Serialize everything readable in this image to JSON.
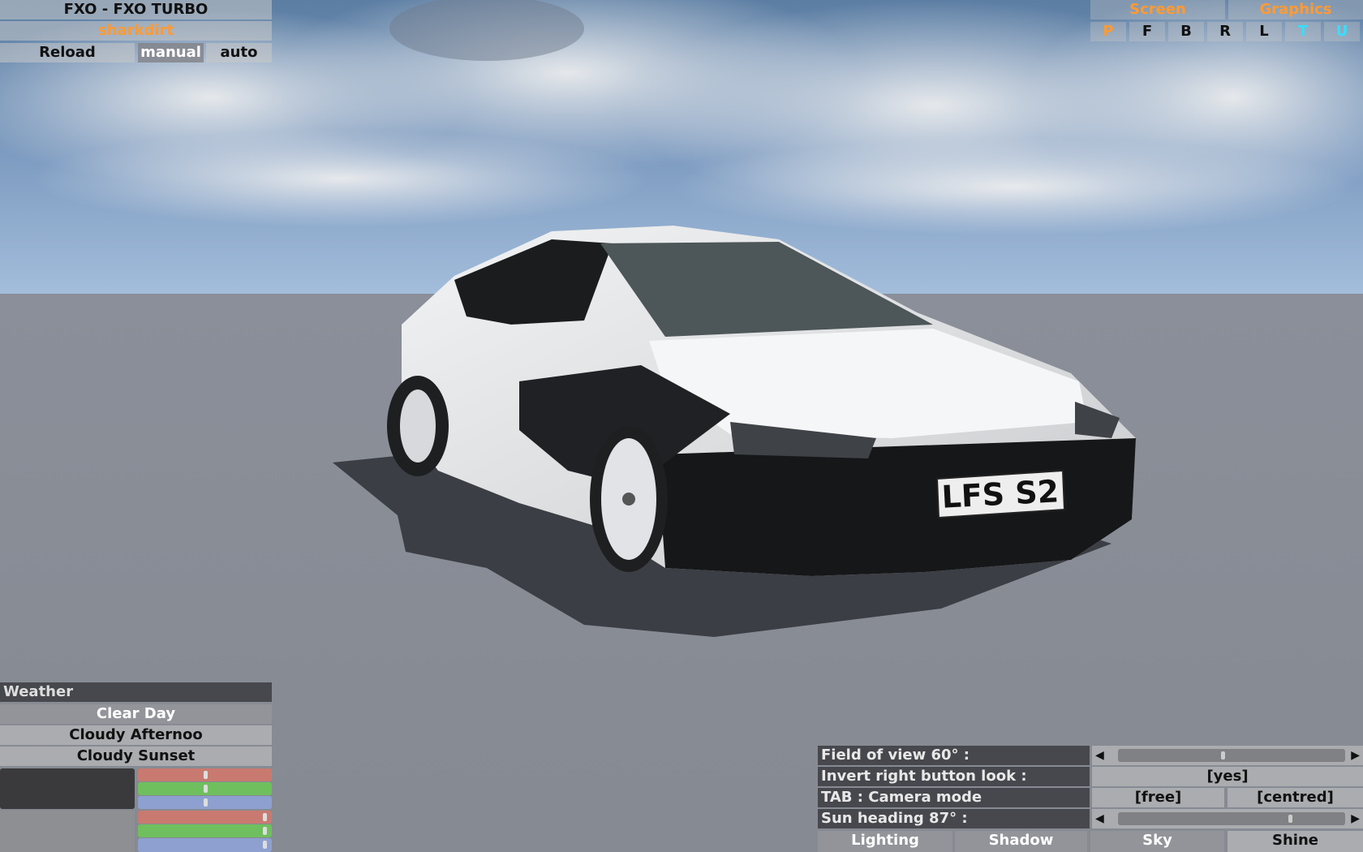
{
  "car_panel": {
    "car_name": "FXO - FXO TURBO",
    "skin_name": "sharkdirt",
    "reload_label": "Reload",
    "manual_label": "manual",
    "auto_label": "auto"
  },
  "top_right": {
    "screen_label": "Screen",
    "graphics_label": "Graphics",
    "view_buttons": [
      "P",
      "F",
      "B",
      "R",
      "L",
      "T",
      "U"
    ]
  },
  "scene": {
    "plate_text": "LFS S2"
  },
  "weather": {
    "header": "Weather",
    "options": [
      "Clear Day",
      "Cloudy Afternoo",
      "Cloudy Sunset"
    ]
  },
  "colors": {
    "orange": "#ff9a33",
    "cyan": "#33e0ff",
    "red_slider": "#c97a70",
    "green_slider": "#6fbf5e",
    "blue_slider": "#8da0cf"
  },
  "settings": {
    "fov_label": "Field of view 60° :",
    "invert_label": "Invert right button look :",
    "invert_value": "[yes]",
    "tab_label": "TAB : Camera mode",
    "camera_free": "[free]",
    "camera_centred": "[centred]",
    "sun_label": "Sun heading 87° :",
    "arrow_left": "◀",
    "arrow_right": "▶"
  },
  "bottom_tabs": [
    "Lighting",
    "Shadow",
    "Sky",
    "Shine"
  ]
}
